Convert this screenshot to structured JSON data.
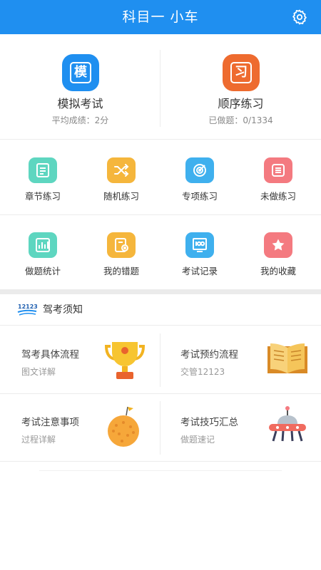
{
  "header": {
    "title": "科目一 小车",
    "settings_icon": "gear-icon"
  },
  "hero": [
    {
      "icon_char": "模",
      "icon_color": "#1f8ff0",
      "title": "模拟考试",
      "sub": "平均成绩：2分"
    },
    {
      "icon_char": "习",
      "icon_color": "#ee6b2f",
      "title": "顺序练习",
      "sub": "已做题：0/1334"
    }
  ],
  "grid": [
    {
      "label": "章节练习",
      "icon": "chapter-icon",
      "color": "#5ed6c0"
    },
    {
      "label": "随机练习",
      "icon": "shuffle-icon",
      "color": "#f5b63c"
    },
    {
      "label": "专项练习",
      "icon": "target-icon",
      "color": "#3fb0ee"
    },
    {
      "label": "未做练习",
      "icon": "list-icon",
      "color": "#f47a80"
    },
    {
      "label": "做题统计",
      "icon": "stats-icon",
      "color": "#5ed6c0"
    },
    {
      "label": "我的错题",
      "icon": "wrong-icon",
      "color": "#f5b63c"
    },
    {
      "label": "考试记录",
      "icon": "record-icon",
      "color": "#3fb0ee"
    },
    {
      "label": "我的收藏",
      "icon": "star-icon",
      "color": "#f47a80"
    }
  ],
  "notice": {
    "logo_text": "12123",
    "title": "驾考须知",
    "items": [
      {
        "title": "驾考具体流程",
        "sub": "图文详解",
        "art": "trophy-icon"
      },
      {
        "title": "考试预约流程",
        "sub": "交管12123",
        "art": "book-icon"
      },
      {
        "title": "考试注意事项",
        "sub": "过程详解",
        "art": "orange-ball-icon"
      },
      {
        "title": "考试技巧汇总",
        "sub": "做题速记",
        "art": "ufo-icon"
      }
    ]
  }
}
